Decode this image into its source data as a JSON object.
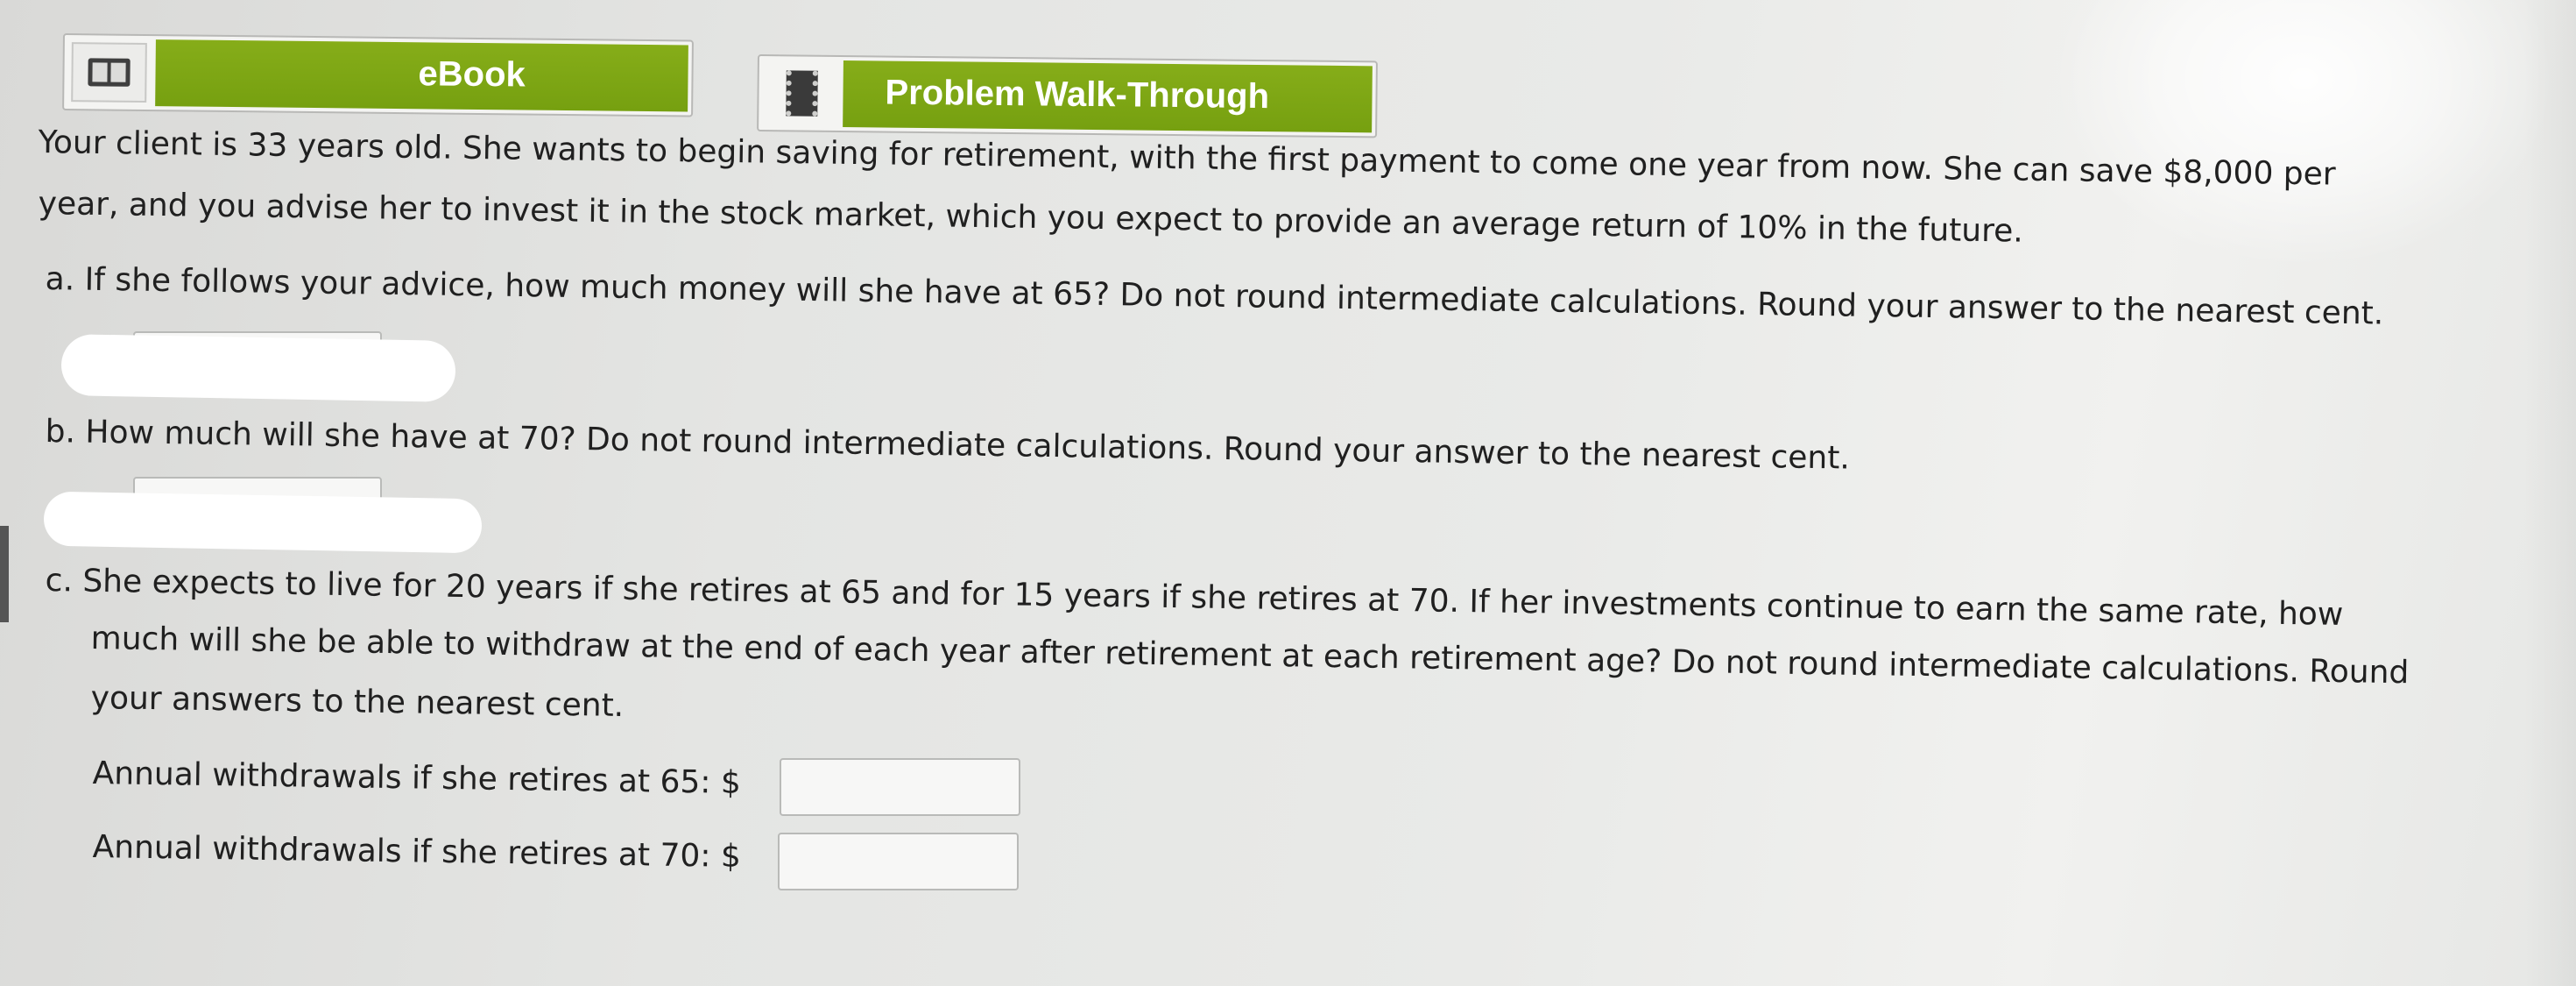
{
  "buttons": {
    "ebook_label": "eBook",
    "walkthrough_label": "Problem Walk-Through"
  },
  "question": {
    "intro_lines": [
      "Your client is 33 years old. She wants to begin saving for retirement, with the first payment to come one year from now. She can save $8,000 per",
      "year, and you advise her to invest it in the stock market, which you expect to provide an average return of 10% in the future."
    ],
    "part_a": "a. If she follows your advice, how much money will she have at 65? Do not round intermediate calculations. Round your answer to the nearest cent.",
    "part_b": "b. How much will she have at 70? Do not round intermediate calculations. Round your answer to the nearest cent.",
    "part_c_lines": [
      "c. She expects to live for 20 years if she retires at 65 and for 15 years if she retires at 70. If her investments continue to earn the same rate, how",
      "much will she be able to withdraw at the end of each year after retirement at each retirement age? Do not round intermediate calculations. Round",
      "your answers to the nearest cent."
    ],
    "withdraw_65_label": "Annual withdrawals if she retires at 65: $",
    "withdraw_70_label": "Annual withdrawals if she retires at 70: $",
    "withdraw_65_value": "",
    "withdraw_70_value": ""
  },
  "colors": {
    "button_green": "#7aa414",
    "text": "#202020"
  },
  "icons": [
    "book-icon",
    "film-icon"
  ]
}
